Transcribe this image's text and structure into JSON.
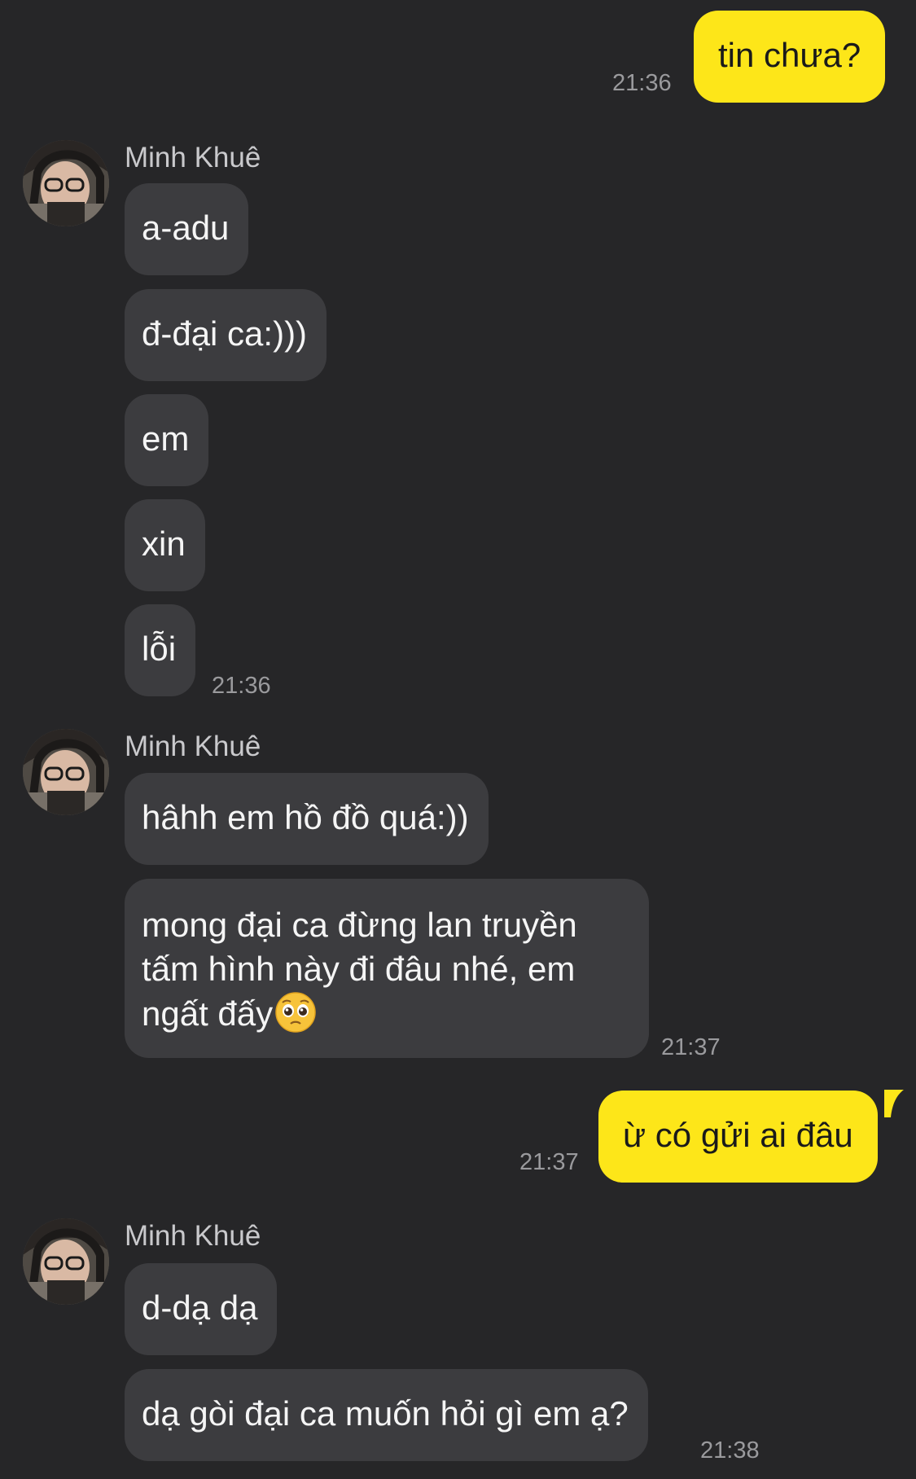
{
  "messages": {
    "m1": {
      "text": "tin chưa?",
      "time": "21:36"
    },
    "g1": {
      "sender": "Minh Khuê",
      "lines": [
        "a-adu",
        "đ-đại ca:)))",
        "em",
        "xin",
        "lỗi"
      ],
      "time": "21:36"
    },
    "g2": {
      "sender": "Minh Khuê",
      "line1": "hâhh em hồ đồ quá:))",
      "line2": "mong đại ca đừng lan truyền tấm hình này đi đâu nhé, em ngất đấy",
      "emoji": "pleading-face-emoji",
      "time": "21:37"
    },
    "m2": {
      "text": "ừ có gửi ai đâu",
      "time": "21:37"
    },
    "g3": {
      "sender": "Minh Khuê",
      "line1": "d-dạ dạ",
      "line2": "dạ gòi đại ca muốn hỏi gì em ạ?",
      "time": "21:38"
    }
  },
  "colors": {
    "background": "#262628",
    "incoming_bubble": "#3c3c3f",
    "outgoing_bubble": "#fde619",
    "timestamp": "#9a9a9d"
  }
}
